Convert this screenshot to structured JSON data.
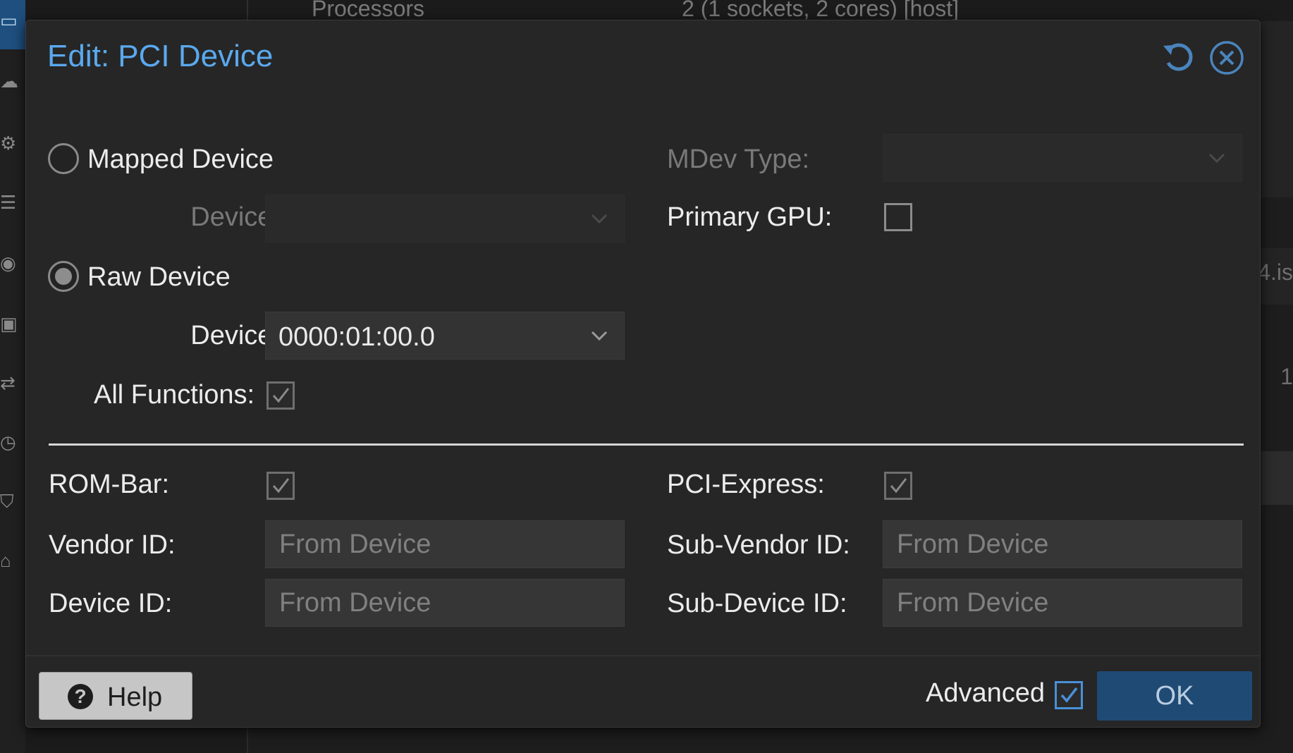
{
  "background": {
    "top_row": {
      "label": "Processors",
      "value": "2 (1 sockets, 2 cores) [host]"
    },
    "right_fragments": [
      "4.is",
      "1"
    ]
  },
  "dialog": {
    "title": "Edit: PCI Device",
    "mapped_device": {
      "label": "Mapped Device",
      "device_label": "Device:",
      "device_value": ""
    },
    "raw_device": {
      "label": "Raw Device",
      "device_label": "Device:",
      "device_value": "0000:01:00.0",
      "all_functions_label": "All Functions:"
    },
    "mdev_type_label": "MDev Type:",
    "primary_gpu_label": "Primary GPU:",
    "rombar_label": "ROM-Bar:",
    "pcie_label": "PCI-Express:",
    "vendor_id": {
      "label": "Vendor ID:",
      "placeholder": "From Device"
    },
    "device_id": {
      "label": "Device ID:",
      "placeholder": "From Device"
    },
    "sub_vendor_id": {
      "label": "Sub-Vendor ID:",
      "placeholder": "From Device"
    },
    "sub_device_id": {
      "label": "Sub-Device ID:",
      "placeholder": "From Device"
    },
    "footer": {
      "help_label": "Help",
      "advanced_label": "Advanced",
      "ok_label": "OK"
    },
    "state": {
      "selected_mode": "Raw Device",
      "all_functions": true,
      "primary_gpu": false,
      "rombar": true,
      "pcie": true,
      "advanced": true
    }
  },
  "colors": {
    "title": "#5aa9ee",
    "accent": "#4a90d9",
    "ok_button": "#1f4a74",
    "dialog_bg": "#262626"
  },
  "icons": [
    "reset-icon",
    "close-icon",
    "chevron-down-icon",
    "checkmark-icon",
    "question-icon"
  ]
}
